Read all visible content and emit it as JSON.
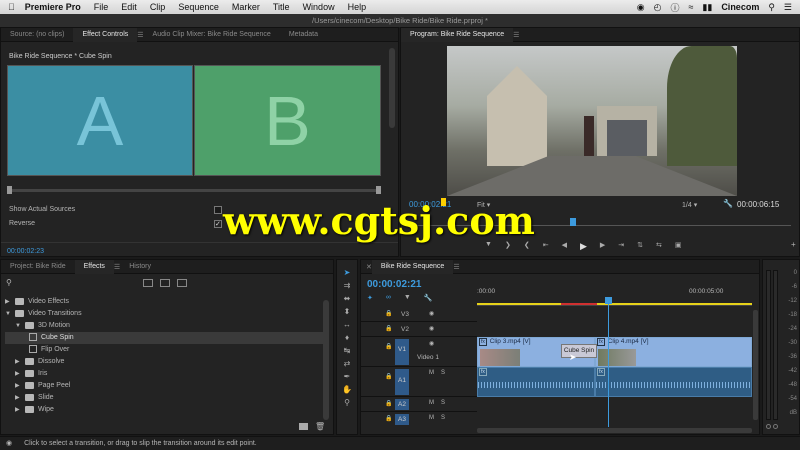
{
  "menubar": {
    "apple": "",
    "app": "Premiere Pro",
    "items": [
      "File",
      "Edit",
      "Clip",
      "Sequence",
      "Marker",
      "Title",
      "Window",
      "Help"
    ],
    "user": "Cinecom"
  },
  "titlebar": {
    "path": "/Users/cinecom/Desktop/Bike Ride/Bike Ride.prproj *"
  },
  "source_panel": {
    "tabs": [
      "Source: (no clips)",
      "Effect Controls",
      "Audio Clip Mixer: Bike Ride Sequence",
      "Metadata"
    ],
    "active_tab": "Effect Controls",
    "header": "Bike Ride Sequence * Cube Spin",
    "preview_a": "A",
    "preview_b": "B",
    "color_a": "#3b8ea3",
    "color_b": "#4ea06a",
    "show_actual_sources": "Show Actual Sources",
    "reverse": "Reverse",
    "timecode": "00:00:02:23"
  },
  "program_panel": {
    "title": "Program: Bike Ride Sequence",
    "timecode": "00:00:02:21",
    "fit": "Fit",
    "fraction": "1/4",
    "duration": "00:00:06:15"
  },
  "project_panel": {
    "tabs": [
      "Project: Bike Ride",
      "Effects",
      "History"
    ],
    "active_tab": "Effects",
    "tree": [
      {
        "label": "Video Effects",
        "type": "folder",
        "indent": 0,
        "open": false
      },
      {
        "label": "Video Transitions",
        "type": "folder",
        "indent": 0,
        "open": true
      },
      {
        "label": "3D Motion",
        "type": "folder",
        "indent": 1,
        "open": true
      },
      {
        "label": "Cube Spin",
        "type": "preset",
        "indent": 2,
        "selected": true
      },
      {
        "label": "Flip Over",
        "type": "preset",
        "indent": 2
      },
      {
        "label": "Dissolve",
        "type": "folder",
        "indent": 1,
        "open": false
      },
      {
        "label": "Iris",
        "type": "folder",
        "indent": 1,
        "open": false
      },
      {
        "label": "Page Peel",
        "type": "folder",
        "indent": 1,
        "open": false
      },
      {
        "label": "Slide",
        "type": "folder",
        "indent": 1,
        "open": false
      },
      {
        "label": "Wipe",
        "type": "folder",
        "indent": 1,
        "open": false
      }
    ]
  },
  "timeline": {
    "tab": "Bike Ride Sequence",
    "timecode": "00:00:02:21",
    "ruler_left": ":00:00",
    "ruler_right": "00:00:05:00",
    "tracks": [
      "V3",
      "V2",
      "V1",
      "A1",
      "A2",
      "A3"
    ],
    "v1_label": "Video 1",
    "clip3": "Clip 3.mp4 [V]",
    "clip4": "Clip 4.mp4 [V]",
    "transition": "Cube Spin",
    "track_letters": {
      "m": "M",
      "s": "S"
    }
  },
  "meter_labels": [
    "0",
    "-6",
    "-12",
    "-18",
    "-24",
    "-30",
    "-36",
    "-42",
    "-48",
    "-54",
    "dB"
  ],
  "statusbar": {
    "text": "Click to select a transition, or drag to slip the transition around its edit point."
  },
  "watermark": "www.cgtsj.com"
}
